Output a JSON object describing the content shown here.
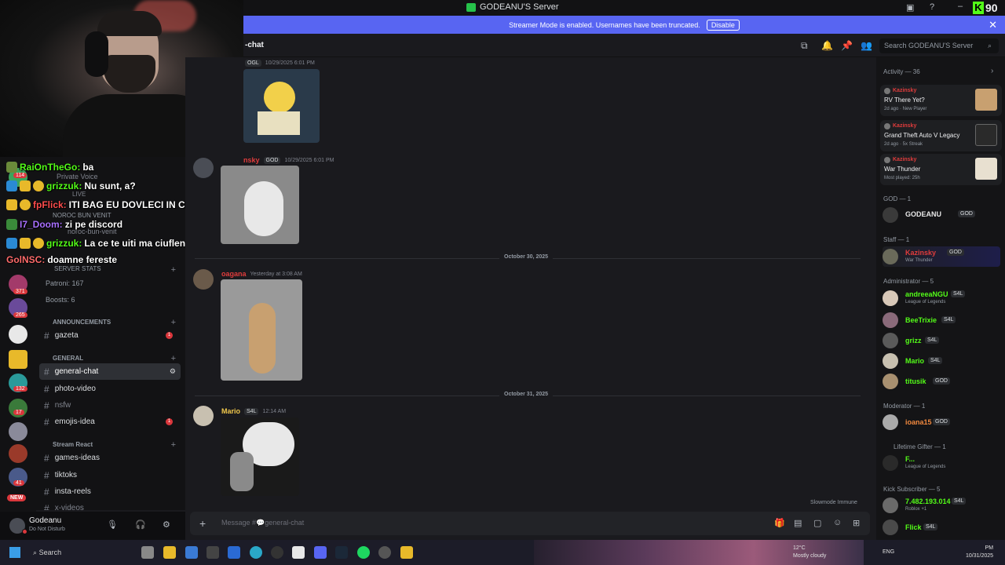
{
  "window": {
    "title": "GODEANU'S Server"
  },
  "banner": {
    "text": "Streamer Mode is enabled. Usernames have been truncated.",
    "button": "Disable"
  },
  "header": {
    "channel": "-chat",
    "search_placeholder": "Search GODEANU'S Server"
  },
  "kick_badge": {
    "letter": "K",
    "count": "90"
  },
  "overlay_chat": [
    {
      "user": "RaiOnTheGo:",
      "text": "ba",
      "color": "#53fc18"
    },
    {
      "user": "grizzuk:",
      "text": "Nu sunt, a?",
      "color": "#53fc18"
    },
    {
      "user": "fpFlick:",
      "text": "ITI BAG EU DOVLECI IN CUR",
      "color": "#ff4d4d"
    },
    {
      "user": "I7_Doom:",
      "text": "zi pe discord",
      "color": "#a970ff"
    },
    {
      "user": "grizzuk:",
      "text": "La ce te uiti ma ciuflenga?",
      "color": "#53fc18"
    },
    {
      "user": "GolNSC:",
      "text": "doamne fereste",
      "color": "#ff6b6b"
    }
  ],
  "channels_partial": [
    "Private Voice",
    "LIVE",
    "NOROC BUN VENIT",
    "noroc-bun-venit",
    "SERVER STATS"
  ],
  "server_stats": {
    "patrons": "Patroni: 167",
    "boosts": "Boosts: 6"
  },
  "categories": {
    "announcements": "ANNOUNCEMENTS",
    "general": "GENERAL",
    "stream": "Stream React"
  },
  "channels": {
    "gazeta": "gazeta",
    "general": "general-chat",
    "photo": "photo-video",
    "nsfw": "nsfw",
    "emojis": "emojis-idea",
    "games": "games-ideas",
    "tiktoks": "tiktoks",
    "reels": "insta-reels",
    "xvideos": "x-videos"
  },
  "server_badges": [
    "114",
    "371",
    "265",
    "132",
    "17",
    "41"
  ],
  "new_badge": "NEW",
  "user": {
    "name": "Godeanu",
    "status": "Do Not Disturb"
  },
  "messages": [
    {
      "tag": "OGL",
      "time": "10/29/2025 6:01 PM"
    },
    {
      "name": "nsky",
      "tag": "GOD",
      "time": "10/29/2025 6:01 PM"
    },
    {
      "name": "oagana",
      "time": "Yesterday at 3:08 AM"
    },
    {
      "name": "Mario",
      "tag": "S4L",
      "time": "12:14 AM"
    }
  ],
  "dividers": [
    "October 30, 2025",
    "October 31, 2025"
  ],
  "composer": {
    "placeholder": "Message #💬general-chat"
  },
  "slowmode": "Slowmode Immune",
  "members": {
    "activity": "Activity — 36",
    "cards": [
      {
        "user": "Kazinsky",
        "title": "RV There Yet?",
        "sub": "2d ago · New Player"
      },
      {
        "user": "Kazinsky",
        "title": "Grand Theft Auto V Legacy",
        "sub": "2d ago · 5x Streak"
      },
      {
        "user": "Kazinsky",
        "title": "War Thunder",
        "sub": "Most played: 25h"
      }
    ],
    "sections": {
      "god": "GOD — 1",
      "staff": "Staff — 1",
      "admin": "Administrator — 5",
      "mod": "Moderator — 1",
      "gifter": "Lifetime Gifter",
      "gifter_count": "— 1",
      "kick": "Kick Subscriber — 5"
    },
    "god": {
      "name": "GODEANU",
      "tag": "GOD"
    },
    "staff": {
      "name": "Kazinsky",
      "tag": "GOD",
      "sub": "War Thunder"
    },
    "admins": [
      {
        "name": "andreeaNGU",
        "tag": "S4L",
        "sub": "League of Legends"
      },
      {
        "name": "BeeTrixie",
        "tag": "S4L",
        "sub": ""
      },
      {
        "name": "grizz",
        "tag": "S4L",
        "sub": ""
      },
      {
        "name": "Mario",
        "tag": "S4L",
        "sub": ""
      },
      {
        "name": "titusik",
        "tag": "GOD",
        "sub": ""
      }
    ],
    "moderator": {
      "name": "ioana15",
      "tag": "GOD"
    },
    "gifter": {
      "name": "F...",
      "sub": "League of Legends"
    },
    "kick_subs": [
      {
        "name": "7.482.193.014",
        "tag": "S4L",
        "sub": "Roblox +1"
      },
      {
        "name": "Flick",
        "tag": "S4L",
        "sub": ""
      }
    ]
  },
  "taskbar": {
    "search": "Search",
    "temp": "12°C",
    "weather": "Mostly cloudy",
    "lang": "ENG",
    "time": "PM",
    "date": "10/31/2025"
  }
}
